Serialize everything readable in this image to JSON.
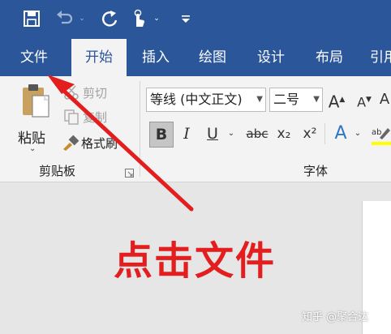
{
  "tabs": [
    "文件",
    "开始",
    "插入",
    "绘图",
    "设计",
    "布局",
    "引用"
  ],
  "clipboard": {
    "paste": "粘贴",
    "cut": "剪切",
    "copy": "复制",
    "format_painter": "格式刷",
    "group_label": "剪贴板"
  },
  "font": {
    "name": "等线 (中文正文)",
    "size": "二号",
    "group_label": "字体",
    "bold": "B",
    "italic": "I",
    "underline": "U",
    "strike": "abc",
    "subscript": "x₂",
    "superscript": "x²"
  },
  "annotation": "点击文件",
  "watermark": "知乎 @聚合达",
  "icons": [
    "save-icon",
    "undo-icon",
    "redo-icon",
    "touch-mode-icon",
    "customize-qat-icon",
    "clipboard-icon",
    "scissors-icon",
    "copy-icon",
    "paintbrush-icon",
    "grow-font-icon",
    "shrink-font-icon",
    "text-effects-icon",
    "highlight-icon",
    "dialog-launcher-icon"
  ],
  "colors": {
    "ribbon_blue": "#2b579a",
    "annotation_red": "#e21e1e"
  }
}
